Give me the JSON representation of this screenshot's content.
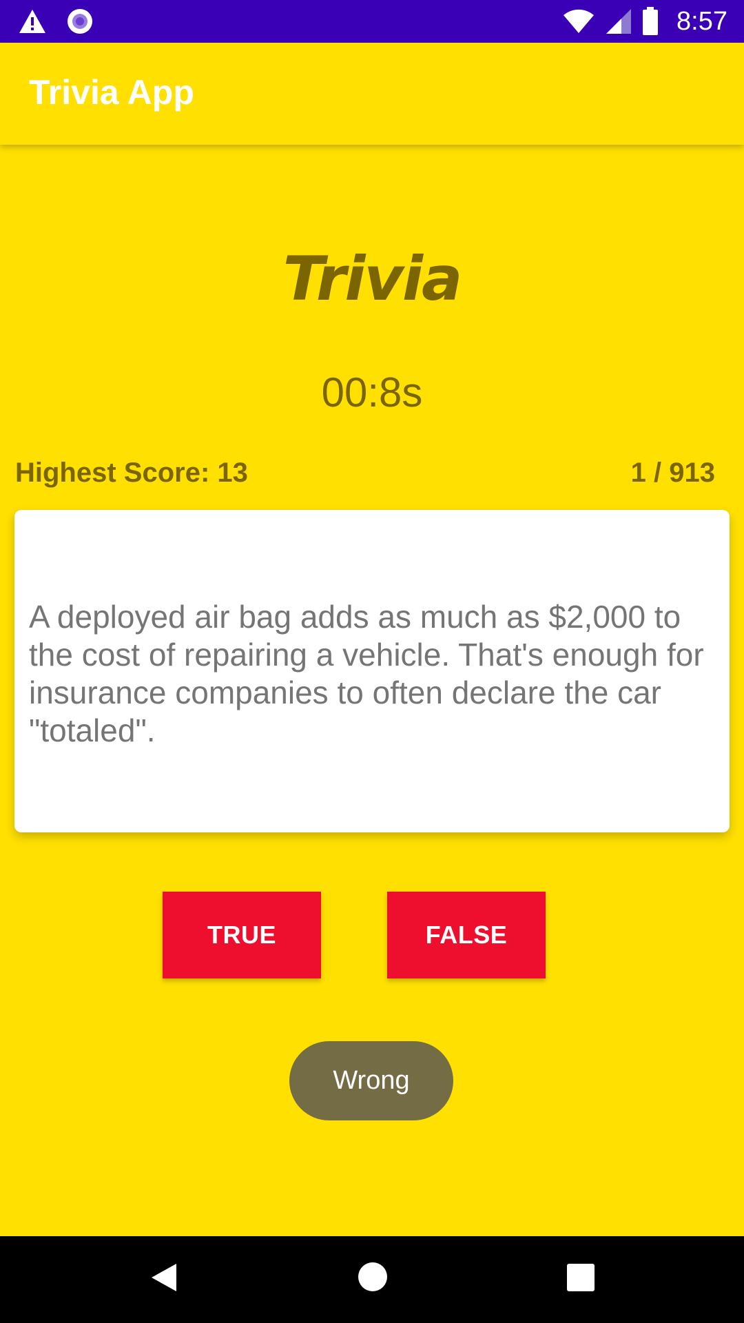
{
  "status_bar": {
    "time": "8:57",
    "background": "#3A00B6",
    "left_icons": [
      "warning-icon",
      "notification-dot-icon"
    ],
    "right_icons": [
      "wifi-icon",
      "signal-icon",
      "battery-icon"
    ]
  },
  "app_bar": {
    "title": "Trivia App"
  },
  "game": {
    "headline": "Trivia",
    "timer": "00:8s",
    "highest_score": "Highest Score: 13",
    "progress": "1 / 913",
    "question": "A deployed air bag adds as much as $2,000 to the cost of repairing a vehicle. That's enough for insurance companies to often declare the car \"totaled\".",
    "true_label": "TRUE",
    "false_label": "FALSE",
    "feedback_toast": "Wrong"
  },
  "colors": {
    "background": "#FFE000",
    "accent_text": "#7A6500",
    "button": "#EE0E2D",
    "toast": "#736C45"
  },
  "nav_bar": {
    "icons": [
      "back-icon",
      "home-icon",
      "recents-icon"
    ]
  }
}
